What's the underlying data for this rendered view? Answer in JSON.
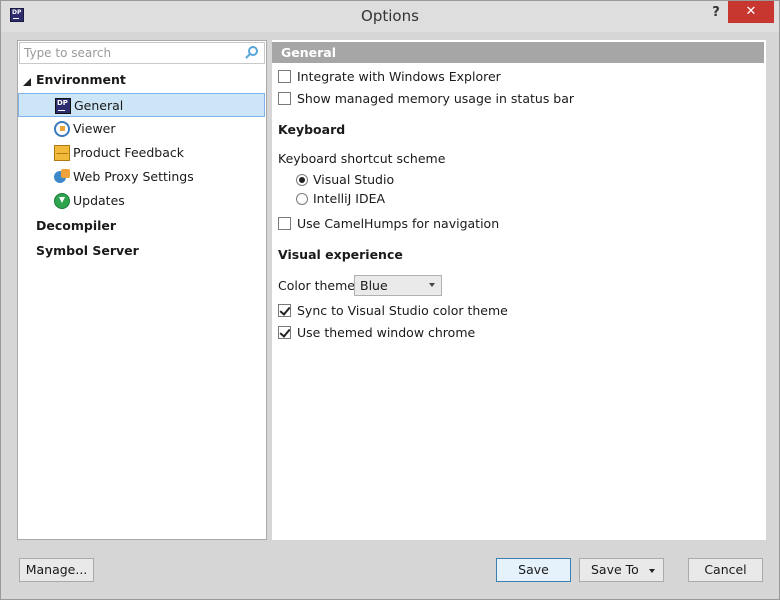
{
  "window": {
    "title": "Options",
    "app_icon_text": "DP",
    "help_label": "?",
    "close_label": "✕"
  },
  "search": {
    "placeholder": "Type to search",
    "icon": "search-icon"
  },
  "tree": {
    "environment": {
      "label": "Environment",
      "expanded": true,
      "items": [
        {
          "label": "General",
          "icon": "dotpeek-icon",
          "selected": true
        },
        {
          "label": "Viewer",
          "icon": "viewer-icon",
          "selected": false
        },
        {
          "label": "Product Feedback",
          "icon": "envelope-icon",
          "selected": false
        },
        {
          "label": "Web Proxy Settings",
          "icon": "proxy-icon",
          "selected": false
        },
        {
          "label": "Updates",
          "icon": "download-icon",
          "selected": false
        }
      ]
    },
    "decompiler": {
      "label": "Decompiler"
    },
    "symbol_server": {
      "label": "Symbol Server"
    }
  },
  "general": {
    "header": "General",
    "integrate_explorer": {
      "label": "Integrate with Windows Explorer",
      "checked": false
    },
    "show_memory": {
      "label": "Show managed memory usage in status bar",
      "checked": false
    },
    "keyboard": {
      "heading": "Keyboard",
      "scheme_label": "Keyboard shortcut scheme",
      "options": [
        {
          "label": "Visual Studio",
          "checked": true
        },
        {
          "label": "IntelliJ IDEA",
          "checked": false
        }
      ],
      "camel_humps": {
        "label": "Use CamelHumps for navigation",
        "checked": false
      }
    },
    "visual": {
      "heading": "Visual experience",
      "color_theme_label": "Color theme:",
      "color_theme_value": "Blue",
      "sync_theme": {
        "label": "Sync to Visual Studio color theme",
        "checked": true
      },
      "themed_chrome": {
        "label": "Use themed window chrome",
        "checked": true
      }
    }
  },
  "buttons": {
    "manage": "Manage...",
    "save": "Save",
    "save_to": "Save To",
    "cancel": "Cancel"
  },
  "colors": {
    "selection_bg": "#cde6f7",
    "selection_border": "#7eb4ea",
    "header_bg": "#a6a6a6",
    "close_bg": "#c7372f"
  }
}
